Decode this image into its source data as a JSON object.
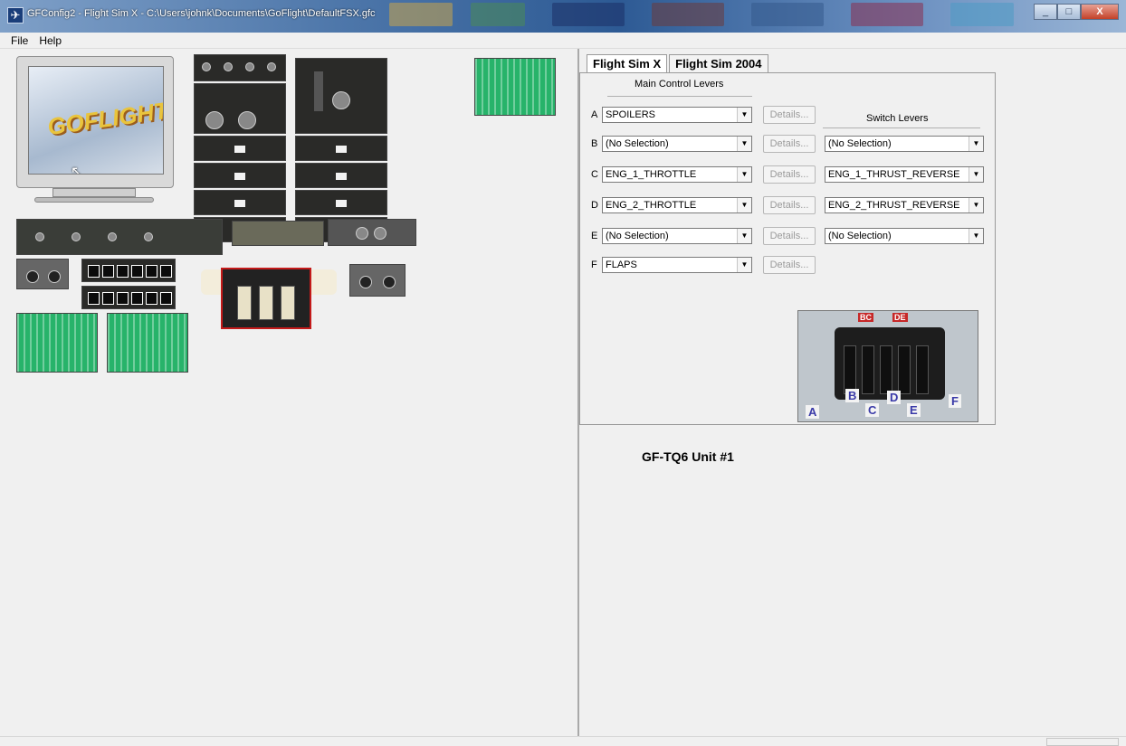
{
  "window": {
    "title": "GFConfig2 - Flight Sim X - C:\\Users\\johnk\\Documents\\GoFlight\\DefaultFSX.gfc",
    "app_icon": "goflight-app-icon"
  },
  "menu": {
    "items": [
      "File",
      "Help"
    ]
  },
  "left_panel": {
    "logo_text": "GOFLIGHT"
  },
  "tabs": [
    {
      "label": "Flight Sim X",
      "active": true
    },
    {
      "label": "Flight Sim 2004",
      "active": false
    }
  ],
  "config": {
    "main_levers_title": "Main Control Levers",
    "switch_levers_title": "Switch Levers",
    "details_label": "Details...",
    "rows": [
      {
        "letter": "A",
        "main": "SPOILERS",
        "switch": null
      },
      {
        "letter": "B",
        "main": "(No Selection)",
        "switch": "(No Selection)"
      },
      {
        "letter": "C",
        "main": "ENG_1_THROTTLE",
        "switch": "ENG_1_THRUST_REVERSE"
      },
      {
        "letter": "D",
        "main": "ENG_2_THROTTLE",
        "switch": "ENG_2_THRUST_REVERSE"
      },
      {
        "letter": "E",
        "main": "(No Selection)",
        "switch": "(No Selection)"
      },
      {
        "letter": "F",
        "main": "FLAPS",
        "switch": null
      }
    ],
    "unit_label": "GF-TQ6 Unit #1",
    "image_tags": [
      "A",
      "B",
      "C",
      "D",
      "E",
      "F"
    ],
    "image_top_tags": [
      "BC",
      "DE"
    ]
  }
}
